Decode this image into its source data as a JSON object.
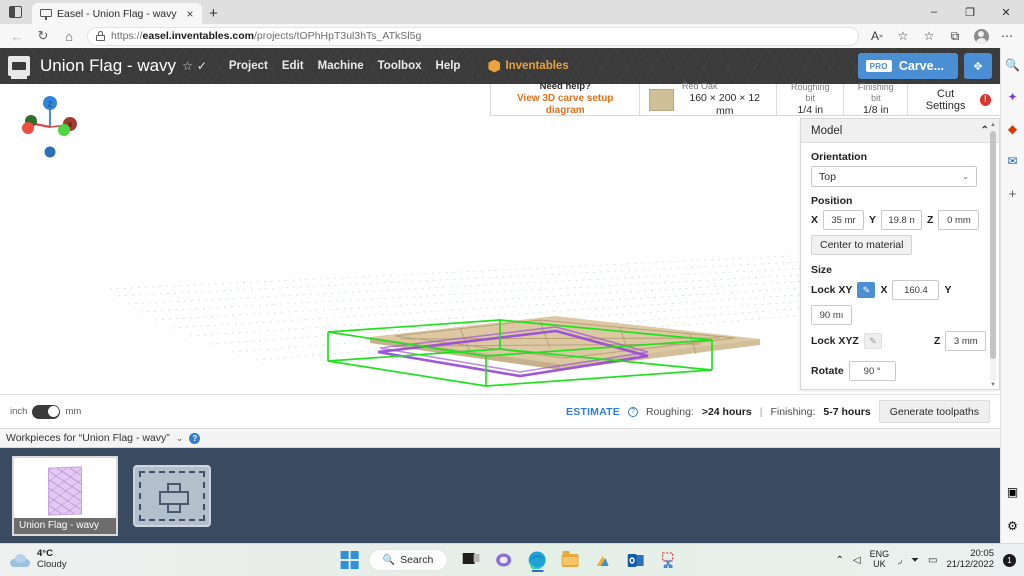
{
  "browser": {
    "tab": {
      "title": "Easel - Union Flag - wavy",
      "favicon": "easel-favicon",
      "close": "×"
    },
    "new_tab": "+",
    "window_controls": {
      "minimize": "–",
      "maximize": "❐",
      "close": "✕"
    },
    "nav": {
      "back": "←",
      "forward": "→",
      "refresh": "↻",
      "home": "⌂"
    },
    "url_prefix": "https://",
    "url_domain": "easel.inventables.com",
    "url_path": "/projects/tOPhHpT3ul3hTs_ATkSl5g",
    "toolbar_icons": [
      "read-aloud-icon",
      "favorite-add-icon",
      "favorites-icon",
      "collections-icon",
      "more-icon"
    ],
    "more": "⋯",
    "sidebar_icons": [
      "search-icon",
      "copilot-icon",
      "office-icon",
      "outlook-icon",
      "add-icon"
    ],
    "sidebar_bottom_icons": [
      "sidebar-toggle-icon",
      "settings-icon"
    ],
    "sidebar_plus": "+"
  },
  "app": {
    "logo": "easel-logo",
    "project_title": "Union Flag - wavy",
    "star": "☆",
    "check": "✓",
    "menus": [
      "Project",
      "Edit",
      "Machine",
      "Toolbox",
      "Help"
    ],
    "inventables_label": "Inventables",
    "carve": {
      "badge": "PRO",
      "label": "Carve..."
    },
    "fullscreen": "✥"
  },
  "info_bar": {
    "help_title": "Need help?",
    "help_link": "View 3D carve setup diagram",
    "material_name": "Red Oak",
    "material_dims": "160 × 200 × 12 mm",
    "material_color": "#cfc09a",
    "roughing_label": "Roughing bit",
    "roughing_value": "1/4 in",
    "finishing_label": "Finishing bit",
    "finishing_value": "1/8 in",
    "cut_settings": "Cut Settings",
    "alert": "!"
  },
  "model_panel": {
    "header": "Model",
    "collapse": "⌃",
    "orientation_label": "Orientation",
    "orientation_value": "Top",
    "orientation_chevron": "⌄",
    "position_label": "Position",
    "position": {
      "x_label": "X",
      "x_value": "35 mr",
      "y_label": "Y",
      "y_value": "19.8 n",
      "z_label": "Z",
      "z_value": "0 mm"
    },
    "center_button": "Center to material",
    "size_label": "Size",
    "lock_xy_label": "Lock XY",
    "lock_xy_icon": "✎",
    "lock_xyz_label": "Lock XYZ",
    "lock_xyz_icon": "✎",
    "size": {
      "x_label": "X",
      "x_value": "160.4",
      "y_label": "Y",
      "y_value": "90 mı",
      "z_label": "Z",
      "z_value": "3 mm"
    },
    "rotate_label": "Rotate",
    "rotate_value": "90 °",
    "scroll_up": "▲",
    "scroll_down": "▼"
  },
  "estimate_bar": {
    "unit_left": "inch",
    "unit_right": "mm",
    "estimate_label": "ESTIMATE",
    "estimate_help": "?",
    "roughing_prefix": "Roughing:",
    "roughing_value": ">24 hours",
    "separator": "|",
    "finishing_prefix": "Finishing:",
    "finishing_value": "5-7 hours",
    "generate_button": "Generate toolpaths"
  },
  "workpieces": {
    "header": "Workpieces for “Union Flag - wavy”",
    "chevron": "⌄",
    "help": "?",
    "cards": [
      {
        "label": "Union Flag - wavy"
      }
    ],
    "add_label": "add-workpiece"
  },
  "taskbar": {
    "weather_temp": "4°C",
    "weather_desc": "Cloudy",
    "search_label": "Search",
    "apps": [
      "task-view-icon",
      "chat-icon",
      "edge-icon",
      "file-explorer-icon",
      "store-icon",
      "outlook-icon",
      "snipping-tool-icon"
    ],
    "overflow_chevron": "⌃",
    "network_icon": "◁",
    "lang_line1": "ENG",
    "lang_line2": "UK",
    "wifi_icon": "◞",
    "volume_icon": "⏷",
    "battery_icon": "▭",
    "time": "20:05",
    "date": "21/12/2022",
    "notification_count": "1"
  },
  "viewport": {
    "axis_gizmo": "axis-gizmo",
    "bounding_box_color": "#22dd22",
    "model_outline_color": "#9a4fd6",
    "material_color": "#d9c49c"
  }
}
